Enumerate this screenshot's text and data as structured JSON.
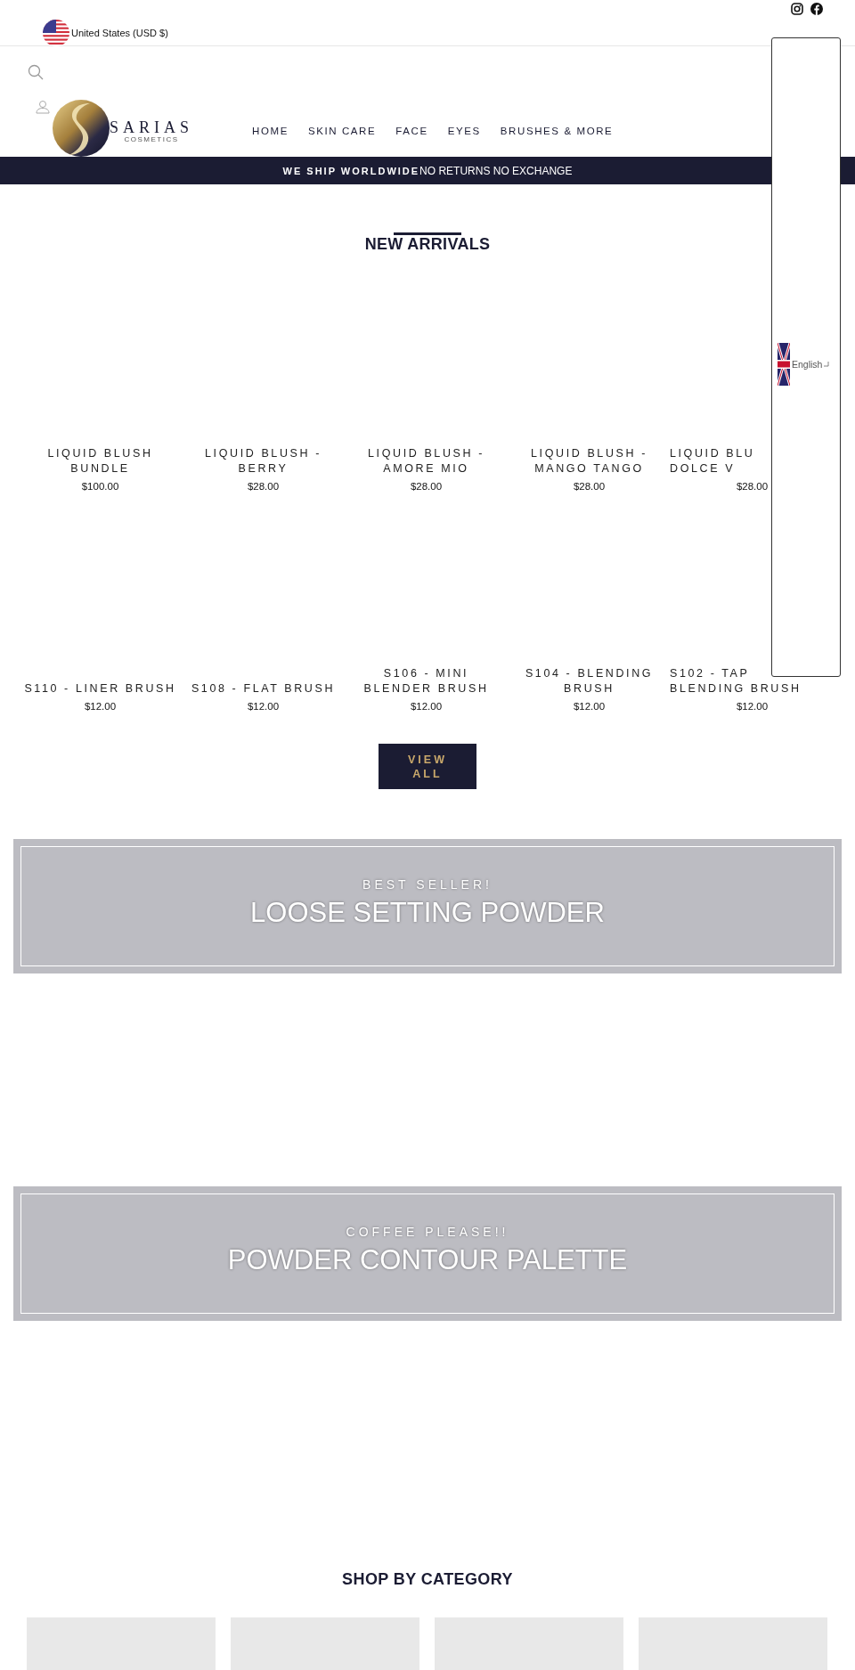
{
  "top_bar": {
    "currency": "United States (USD $)"
  },
  "logo": {
    "name": "SARIAS",
    "tagline": "COSMETICS"
  },
  "nav": [
    "HOME",
    "SKIN CARE",
    "FACE",
    "EYES",
    "BRUSHES & MORE"
  ],
  "announcement": {
    "bold": "WE SHIP WORLDWIDE",
    "text": "NO RETURNS NO EXCHANGE"
  },
  "new_arrivals": {
    "title": "NEW ARRIVALS",
    "products": [
      {
        "lines": [
          "LIQUID BLUSH",
          "BUNDLE"
        ],
        "price": "$100.00"
      },
      {
        "lines": [
          "LIQUID BLUSH -",
          "BERRY"
        ],
        "price": "$28.00"
      },
      {
        "lines": [
          "LIQUID BLUSH -",
          "AMORE MIO"
        ],
        "price": "$28.00"
      },
      {
        "lines": [
          "LIQUID BLUSH -",
          "MANGO TANGO"
        ],
        "price": "$28.00"
      },
      {
        "lines": [
          "LIQUID BLU",
          "DOLCE V"
        ],
        "price": "$28.00"
      },
      {
        "lines": [
          "S110 - LINER BRUSH"
        ],
        "price": "$12.00"
      },
      {
        "lines": [
          "S108 - FLAT BRUSH"
        ],
        "price": "$12.00"
      },
      {
        "lines": [
          "S106 - MINI",
          "BLENDER BRUSH"
        ],
        "price": "$12.00"
      },
      {
        "lines": [
          "S104 - BLENDING",
          "BRUSH"
        ],
        "price": "$12.00"
      },
      {
        "lines": [
          "S102 - TAP",
          "BLENDING BRUSH"
        ],
        "price": "$12.00"
      }
    ],
    "button": "VIEW ALL"
  },
  "banners": [
    {
      "subtitle": "BEST SELLER!",
      "title": "LOOSE SETTING POWDER"
    },
    {
      "subtitle": "COFFEE PLEASE!!",
      "title": "POWDER CONTOUR PALETTE"
    }
  ],
  "shop_by_category": {
    "title": "SHOP BY CATEGORY"
  },
  "language_panel": {
    "language": "English"
  }
}
